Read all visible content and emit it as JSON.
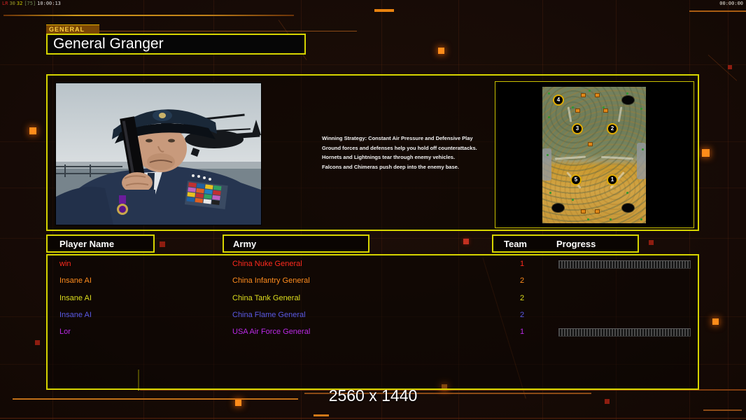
{
  "hud": {
    "debug": {
      "label": "LR",
      "v1": "30",
      "v2": "32",
      "v3": "[75]",
      "time": "10:00:13"
    },
    "match_timer": "00:00:00",
    "resolution": "2560 x 1440"
  },
  "general_select": {
    "tab": "GENERAL",
    "name": "General Granger"
  },
  "briefing": {
    "lines": [
      "Winning Strategy: Constant Air Pressure and Defensive Play",
      "Ground forces and defenses help you hold off counterattacks.",
      "Hornets and Lightnings tear through enemy vehicles.",
      "Falcons and Chimeras push deep into the enemy base."
    ]
  },
  "minimap": {
    "start_positions": [
      "4",
      "3",
      "2",
      "5",
      "1"
    ]
  },
  "roster": {
    "headers": {
      "player": "Player Name",
      "army": "Army",
      "team": "Team",
      "progress": "Progress"
    },
    "rows": [
      {
        "player": "win",
        "army": "China Nuke General",
        "team": "1",
        "color": "#ff2a1e",
        "has_progress": true
      },
      {
        "player": "Insane AI",
        "army": "China Infantry General",
        "team": "2",
        "color": "#ff8c1e",
        "has_progress": false
      },
      {
        "player": "Insane AI",
        "army": "China Tank General",
        "team": "2",
        "color": "#dede1e",
        "has_progress": false
      },
      {
        "player": "Insane AI",
        "army": "China Flame General",
        "team": "2",
        "color": "#5a5ae6",
        "has_progress": false
      },
      {
        "player": "Lor",
        "army": "USA Air Force General",
        "team": "1",
        "color": "#bb2ae6",
        "has_progress": true
      }
    ]
  },
  "colors": {
    "accent": "#d6d400",
    "background": "#170b06",
    "circuit": "#8c3c14",
    "debug_label": "#cc2222",
    "debug_v1": "#99992e",
    "debug_v2": "#cccc00",
    "debug_v3": "#6f8a55",
    "debug_time": "#dddddd"
  }
}
